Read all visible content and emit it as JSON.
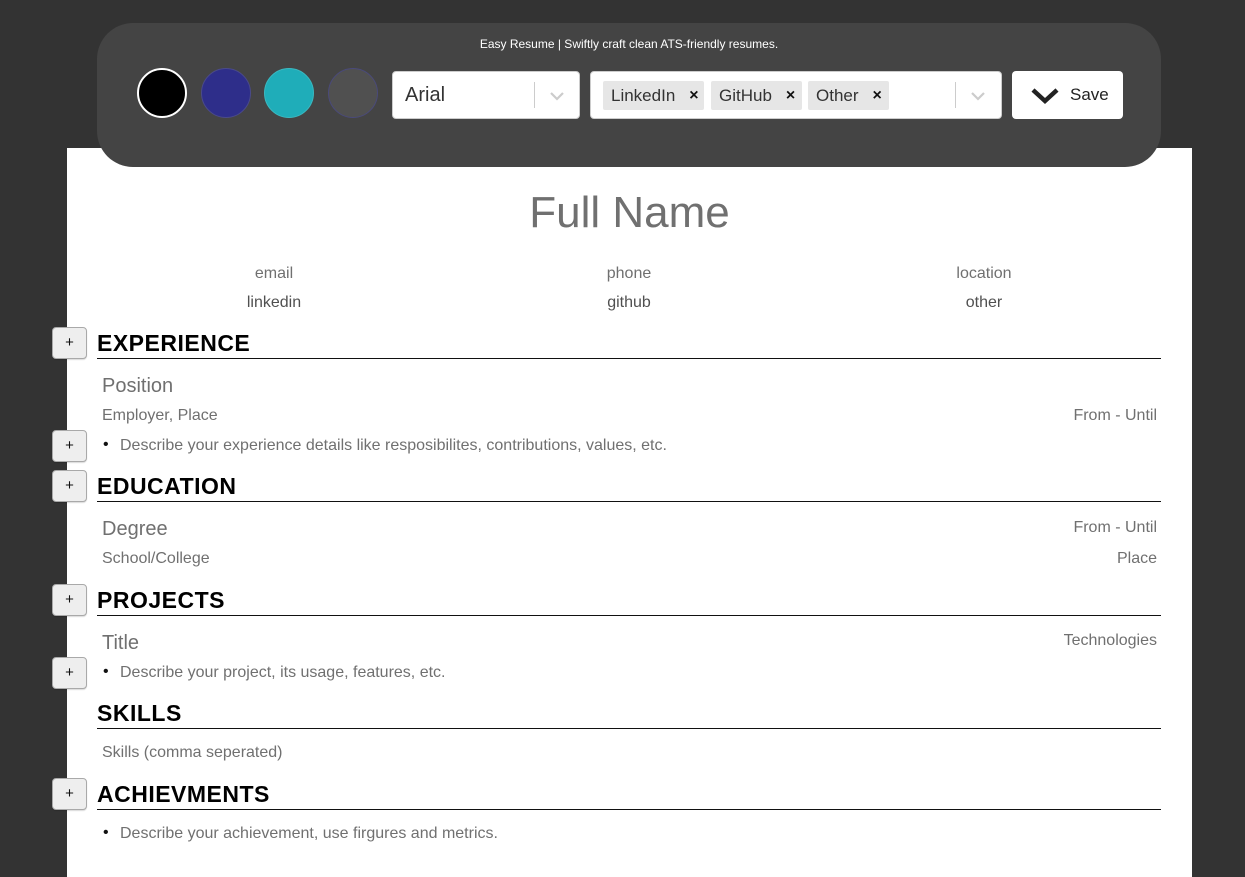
{
  "toolbar": {
    "tagline": "Easy Resume | Swiftly craft clean ATS-friendly resumes.",
    "colors": [
      "#000000",
      "#2e2e8a",
      "#1fadb9",
      "#505050"
    ],
    "font_select": {
      "value": "Arial"
    },
    "links_select": {
      "chips": [
        "LinkedIn",
        "GitHub",
        "Other"
      ]
    },
    "save_label": "Save"
  },
  "resume": {
    "full_name": "Full Name",
    "contacts": {
      "email": "email",
      "phone": "phone",
      "location": "location",
      "linkedin": "linkedin",
      "github": "github",
      "other": "other"
    },
    "add_label": "+",
    "experience": {
      "title": "EXPERIENCE",
      "position": "Position",
      "employer_place": "Employer, Place",
      "dates": "From - Until",
      "bullet": "Describe your experience details like resposibilites, contributions, values, etc."
    },
    "education": {
      "title": "EDUCATION",
      "degree": "Degree",
      "dates": "From - Until",
      "school": "School/College",
      "place": "Place"
    },
    "projects": {
      "title": "PROJECTS",
      "project_title": "Title",
      "technologies": "Technologies",
      "bullet": "Describe your project, its usage, features, etc."
    },
    "skills": {
      "title": "SKILLS",
      "placeholder": "Skills (comma seperated)"
    },
    "achievements": {
      "title": "ACHIEVMENTS",
      "bullet": "Describe your achievement, use firgures and metrics."
    }
  }
}
